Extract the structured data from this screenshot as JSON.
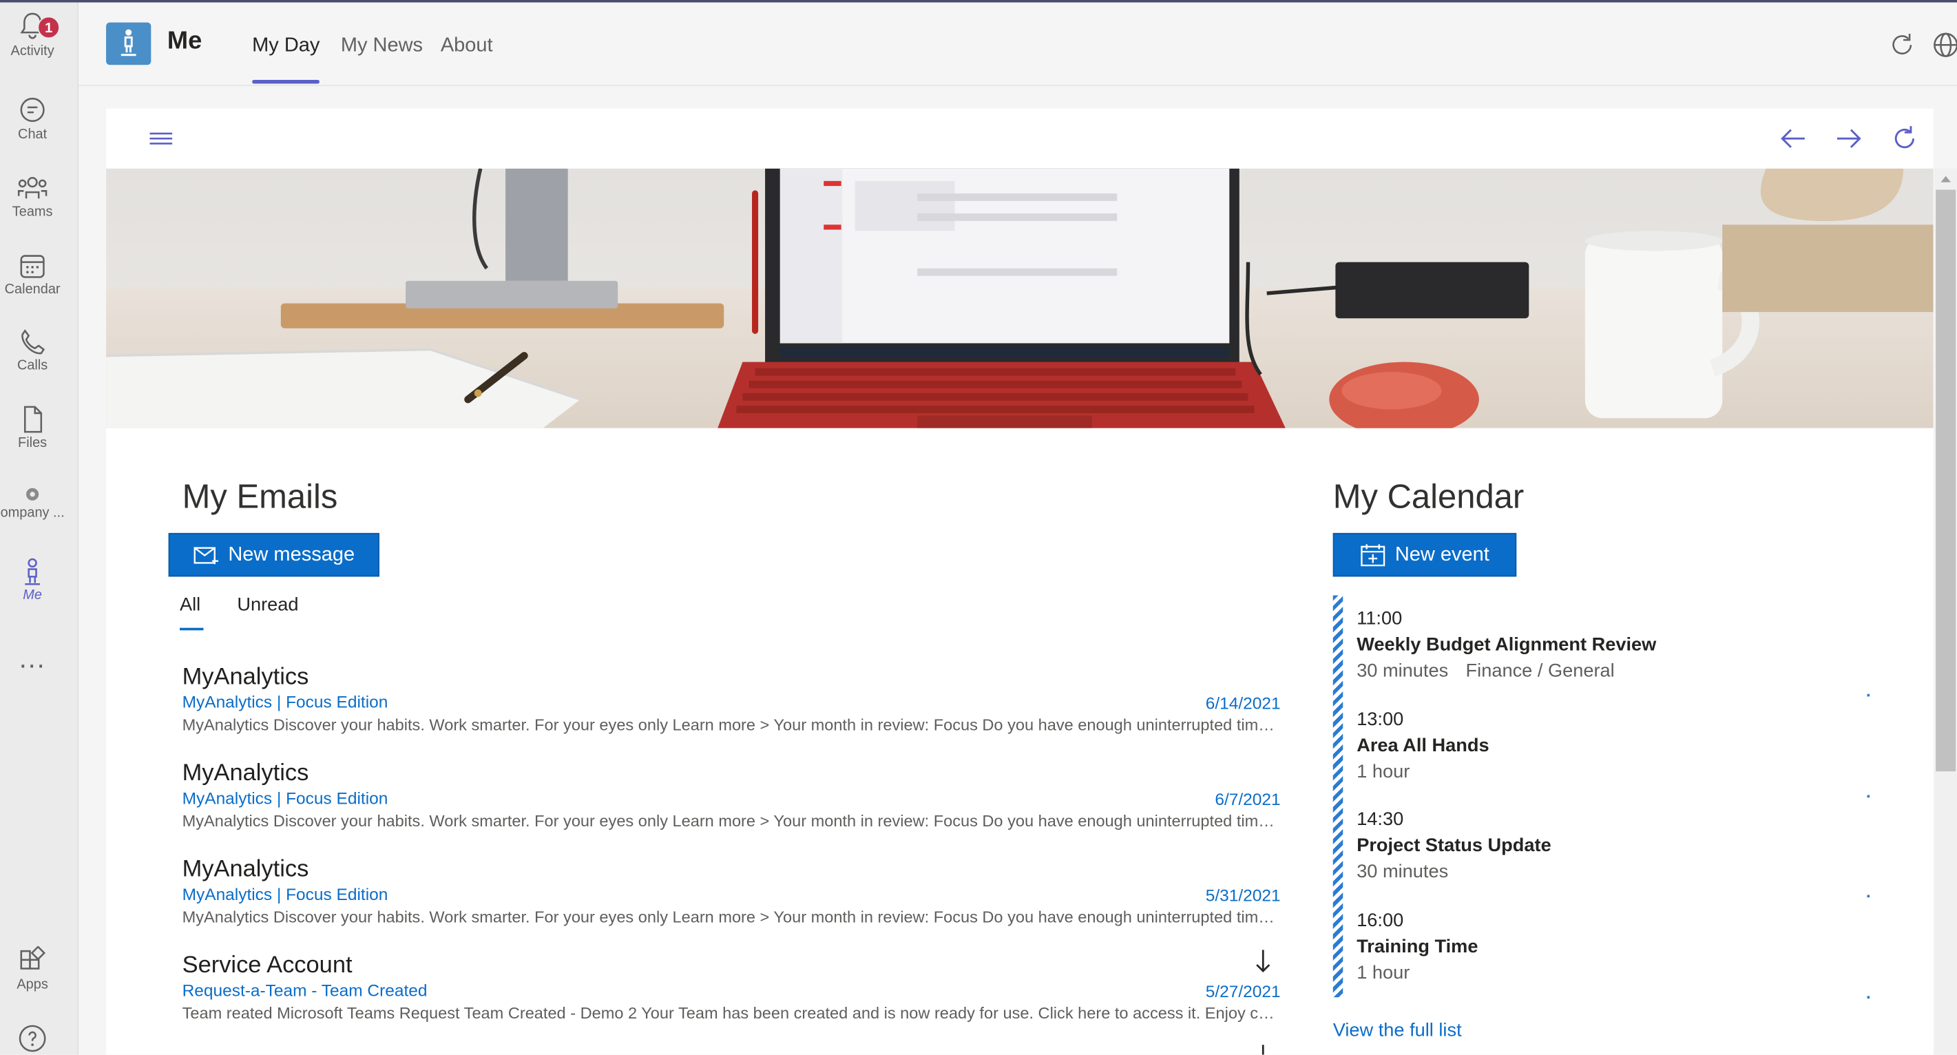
{
  "rail": {
    "activity": {
      "label": "Activity",
      "badge": "1"
    },
    "chat": {
      "label": "Chat"
    },
    "teams": {
      "label": "Teams"
    },
    "calendar": {
      "label": "Calendar"
    },
    "calls": {
      "label": "Calls"
    },
    "files": {
      "label": "Files"
    },
    "company": {
      "label": "ompany ..."
    },
    "me": {
      "label": "Me"
    },
    "more": {
      "label": "..."
    },
    "apps": {
      "label": "Apps"
    }
  },
  "header": {
    "title": "Me",
    "tabs": [
      "My Day",
      "My News",
      "About"
    ],
    "active_tab": "My Day"
  },
  "emails": {
    "title": "My Emails",
    "new_button": "New message",
    "filters": [
      "All",
      "Unread"
    ],
    "active_filter": "All",
    "items": [
      {
        "sender": "MyAnalytics",
        "subject": "MyAnalytics | Focus Edition",
        "date": "6/14/2021",
        "preview": "MyAnalytics Discover your habits. Work smarter. For your eyes only Learn more > Your month in review: Focus Do you have enough uninterrupted time to g..."
      },
      {
        "sender": "MyAnalytics",
        "subject": "MyAnalytics | Focus Edition",
        "date": "6/7/2021",
        "preview": "MyAnalytics Discover your habits. Work smarter. For your eyes only Learn more > Your month in review: Focus Do you have enough uninterrupted time to g..."
      },
      {
        "sender": "MyAnalytics",
        "subject": "MyAnalytics | Focus Edition",
        "date": "5/31/2021",
        "preview": "MyAnalytics Discover your habits. Work smarter. For your eyes only Learn more > Your month in review: Focus Do you have enough uninterrupted time to g..."
      },
      {
        "sender": "Service Account",
        "subject": "Request-a-Team - Team Created",
        "date": "5/27/2021",
        "preview": "Team reated Microsoft Teams Request Team Created - Demo 2 Your Team has been created and is now ready for use. Click here to access it. Enjoy collaborati..."
      }
    ]
  },
  "calendar": {
    "title": "My Calendar",
    "new_button": "New event",
    "items": [
      {
        "time": "11:00",
        "title": "Weekly Budget Alignment Review",
        "duration": "30 minutes",
        "location": "Finance / General"
      },
      {
        "time": "13:00",
        "title": "Area All Hands",
        "duration": "1 hour",
        "location": ""
      },
      {
        "time": "14:30",
        "title": "Project Status Update",
        "duration": "30 minutes",
        "location": ""
      },
      {
        "time": "16:00",
        "title": "Training Time",
        "duration": "1 hour",
        "location": ""
      }
    ],
    "full_list_link": "View the full list"
  },
  "colors": {
    "accent": "#5b5fc7",
    "primary_button": "#0a6dc9",
    "link": "#0a6dc9",
    "badge": "#c4314b"
  }
}
